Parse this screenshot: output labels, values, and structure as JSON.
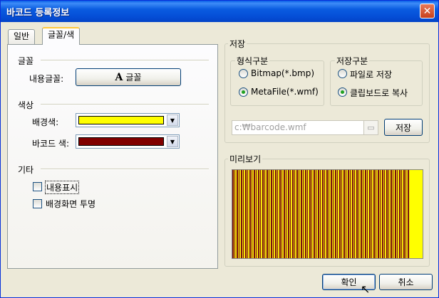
{
  "window": {
    "title": "바코드 등록정보",
    "close": "✕"
  },
  "tabs": [
    {
      "label": "일반",
      "active": false
    },
    {
      "label": "글꼴/색",
      "active": true
    }
  ],
  "font_section": {
    "title": "글꼴",
    "content_font_label": "내용글꼴:",
    "font_button_icon": "A",
    "font_button_label": "글꼴"
  },
  "color_section": {
    "title": "색상",
    "background_label": "배경색:",
    "background_color": "#ffff00",
    "barcode_label": "바코드 색:",
    "barcode_color": "#800000"
  },
  "etc_section": {
    "title": "기타",
    "show_content": {
      "label": "내용표시",
      "checked": false
    },
    "transparent_bg": {
      "label": "배경화면 투명",
      "checked": false
    }
  },
  "save_section": {
    "title": "저장",
    "format_group": {
      "title": "형식구분",
      "options": [
        {
          "label": "Bitmap(*.bmp)",
          "selected": false
        },
        {
          "label": "MetaFile(*.wmf)",
          "selected": true
        }
      ]
    },
    "save_group": {
      "title": "저장구분",
      "options": [
        {
          "label": "파일로 저장",
          "selected": false
        },
        {
          "label": "클립보드로 복사",
          "selected": true
        }
      ]
    },
    "path_value": "c:₩barcode.wmf",
    "save_button": "저장"
  },
  "preview_section": {
    "title": "미리보기"
  },
  "buttons": {
    "ok": "확인",
    "cancel": "취소"
  }
}
